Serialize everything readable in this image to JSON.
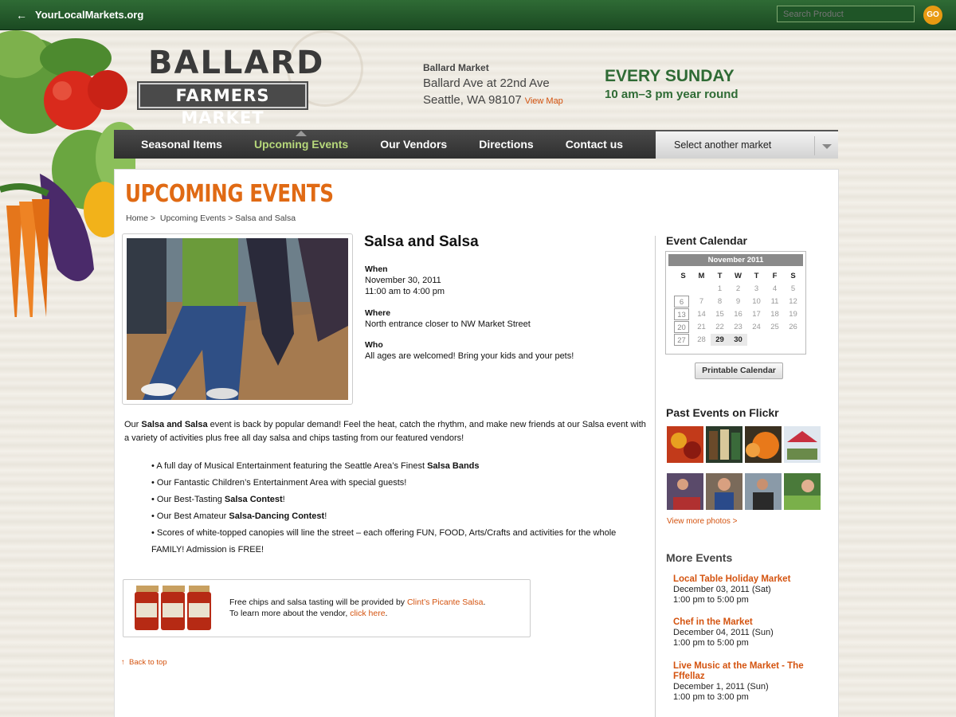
{
  "topbar": {
    "back_label": "YourLocalMarkets.org",
    "search_placeholder": "Search Product",
    "go_label": "GO"
  },
  "logo": {
    "line1": "BALLARD",
    "line2": "FARMERS MARKET"
  },
  "address": {
    "name": "Ballard Market",
    "street": "Ballard Ave at 22nd Ave",
    "city": "Seattle, WA 98107",
    "map_link": "View Map"
  },
  "schedule": {
    "day": "EVERY SUNDAY",
    "hours": "10 am–3 pm year round"
  },
  "nav": {
    "items": [
      "Seasonal Items",
      "Upcoming Events",
      "Our Vendors",
      "Directions",
      "Contact us"
    ],
    "active": "Upcoming Events",
    "select_label": "Select another market"
  },
  "page": {
    "title": "UPCOMING EVENTS",
    "breadcrumb": [
      "Home",
      "Upcoming Events",
      "Salsa and Salsa"
    ]
  },
  "event": {
    "title": "Salsa and Salsa",
    "when_label": "When",
    "when_date": "November 30, 2011",
    "when_time": "11:00 am to 4:00 pm",
    "where_label": "Where",
    "where_value": "North entrance closer to NW Market Street",
    "who_label": "Who",
    "who_value": "All ages are welcomed! Bring your kids and your pets!",
    "intro_pre": "Our ",
    "intro_bold": "Salsa and Salsa",
    "intro_post": " event is back by popular demand! Feel the heat, catch the rhythm, and make new friends at our Salsa event with a variety of activities plus free all day salsa and chips tasting from our featured vendors!",
    "bullets": [
      {
        "pre": " A full day of Musical Entertainment featuring the Seattle Area’s Finest ",
        "bold": "Salsa Bands",
        "post": ""
      },
      {
        "pre": "Our Fantastic Children’s Entertainment Area with special guests!",
        "bold": "",
        "post": ""
      },
      {
        "pre": "Our Best-Tasting ",
        "bold": "Salsa Contest",
        "post": "!"
      },
      {
        "pre": "Our Best Amateur ",
        "bold": "Salsa-Dancing Contest",
        "post": "!"
      },
      {
        "pre": "Scores of white-topped canopies will line the street – each offering FUN, FOOD, Arts/Crafts and activities for the whole FAMILY! Admission is FREE!",
        "bold": "",
        "post": ""
      }
    ]
  },
  "vendor": {
    "line1_pre": "Free chips and salsa tasting will be provided by ",
    "line1_link": "Clint’s Picante Salsa",
    "line1_post": ".",
    "line2_pre": "To learn more about the vendor, ",
    "line2_link": "click here",
    "line2_post": "."
  },
  "back_to_top": "Back to top",
  "calendar": {
    "heading": "Event Calendar",
    "month": "November 2011",
    "day_headers": [
      "S",
      "M",
      "T",
      "W",
      "T",
      "F",
      "S"
    ],
    "days": [
      "",
      "",
      "1",
      "2",
      "3",
      "4",
      "5",
      "6",
      "7",
      "8",
      "9",
      "10",
      "11",
      "12",
      "13",
      "14",
      "15",
      "16",
      "17",
      "18",
      "19",
      "20",
      "21",
      "22",
      "23",
      "24",
      "25",
      "26",
      "27",
      "28",
      "29",
      "30"
    ],
    "boxed_days": [
      "6",
      "13",
      "20",
      "27"
    ],
    "bold_days": [
      "29",
      "30"
    ],
    "print_label": "Printable Calendar"
  },
  "flickr": {
    "heading": "Past Events on Flickr",
    "more": "View more photos >"
  },
  "more_events": {
    "heading": "More Events",
    "items": [
      {
        "title": "Local Table Holiday Market",
        "date": "December 03, 2011 (Sat)",
        "time": "1:00 pm to 5:00 pm"
      },
      {
        "title": "Chef in the Market",
        "date": "December 04, 2011 (Sun)",
        "time": "1:00 pm to 5:00 pm"
      },
      {
        "title": "Live Music at the Market - The Fffellaz",
        "date": "December 1, 2011 (Sun)",
        "time": "1:00 pm to 3:00 pm"
      }
    ]
  },
  "colors": {
    "accent": "#e06a14",
    "link": "#d4530f",
    "green": "#2f6b35",
    "nav_active": "#b6d77a"
  }
}
